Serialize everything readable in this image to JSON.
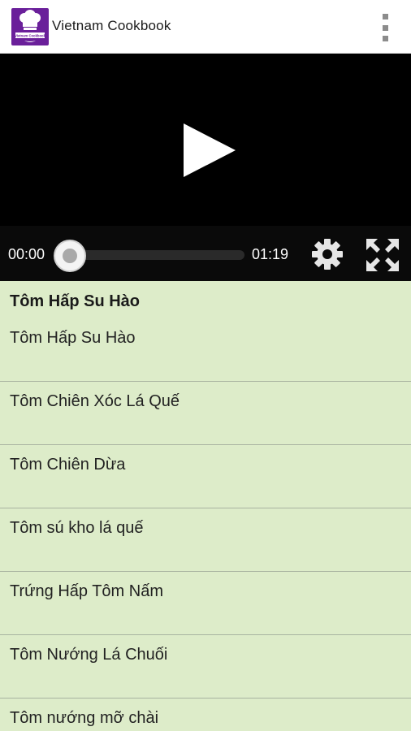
{
  "app": {
    "title": "Vietnam Cookbook",
    "logo_text": "Vietnam Cookbook",
    "brand_color": "#6a1f9a"
  },
  "menu": {
    "icon": "overflow-menu-icon"
  },
  "video": {
    "current_time": "00:00",
    "total_time": "01:19",
    "progress": 0,
    "play_icon": "play-icon",
    "settings_icon": "gear-icon",
    "fullscreen_icon": "fullscreen-icon"
  },
  "section": {
    "title": "Tôm Hấp Su Hào"
  },
  "recipes": [
    {
      "label": "Tôm Hấp Su Hào"
    },
    {
      "label": "Tôm Chiên Xóc Lá Quế"
    },
    {
      "label": "Tôm Chiên Dừa"
    },
    {
      "label": "Tôm sú kho lá quế"
    },
    {
      "label": "Trứng Hấp Tôm Nấm"
    },
    {
      "label": "Tôm Nướng Lá Chuối"
    },
    {
      "label": "Tôm nướng mỡ chài"
    }
  ],
  "colors": {
    "list_background": "#ddecc9",
    "video_background": "#000000"
  }
}
